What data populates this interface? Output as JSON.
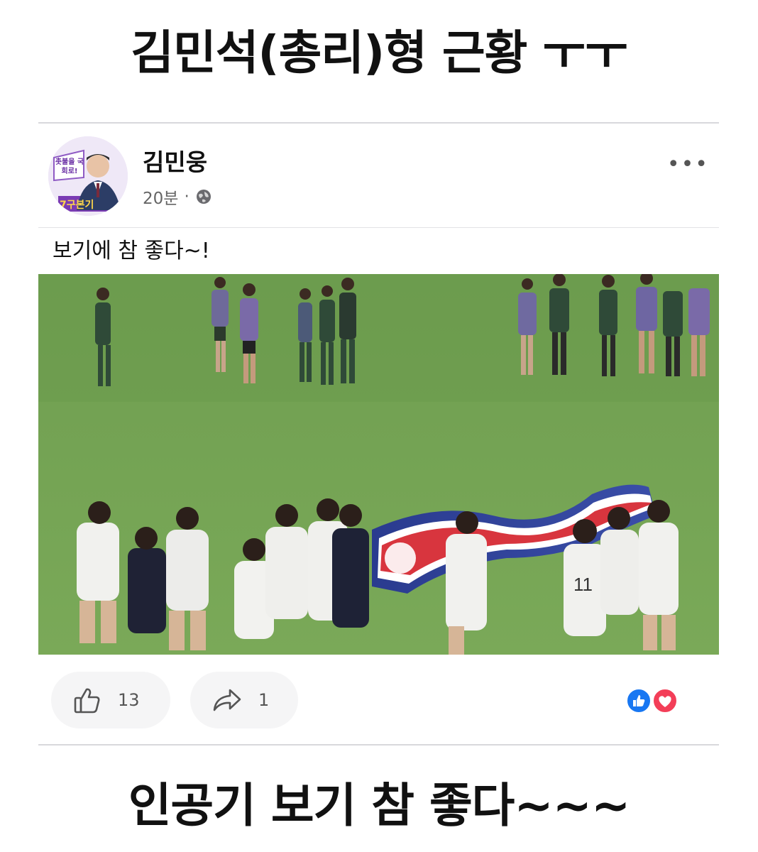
{
  "top_caption": "김민석(총리)형 근황 ㅜㅜ",
  "post": {
    "author": "김민웅",
    "time": "20분",
    "separator": "·",
    "audience_icon": "globe-icon",
    "more_icon": "more-options-icon",
    "more_label": "•••",
    "text": "보기에 참 좋다~!",
    "avatar": {
      "banner_top": "촛불을 국회로!",
      "banner_bottom": "7구본기"
    }
  },
  "actions": {
    "like_count": "13",
    "share_count": "1"
  },
  "bottom_caption": "인공기 보기 참 좋다~~~",
  "colors": {
    "field_green": "#76a855",
    "field_dark": "#5f8f45",
    "like_blue": "#1877f2",
    "love_red": "#f33e58"
  }
}
